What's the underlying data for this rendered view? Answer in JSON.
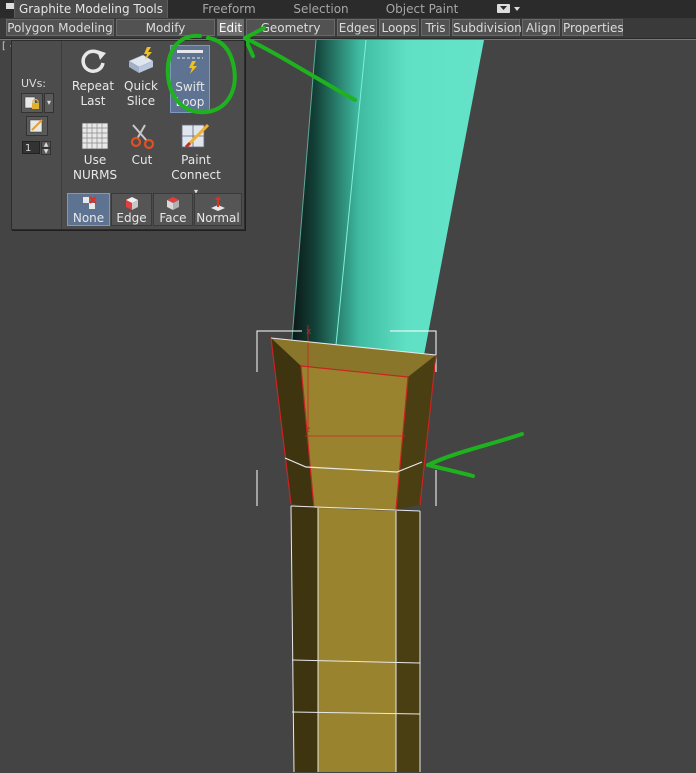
{
  "ribbon": {
    "tabs": [
      {
        "label": "Graphite Modeling Tools",
        "active": true
      },
      {
        "label": "Freeform",
        "active": false
      },
      {
        "label": "Selection",
        "active": false
      },
      {
        "label": "Object Paint",
        "active": false
      }
    ],
    "sub_tabs": [
      {
        "label": "Polygon Modeling",
        "active": false
      },
      {
        "label": "Modify Selection",
        "active": false
      },
      {
        "label": "Edit",
        "active": true
      },
      {
        "label": "Geometry (All)",
        "active": false
      },
      {
        "label": "Edges",
        "active": false
      },
      {
        "label": "Loops",
        "active": false
      },
      {
        "label": "Tris",
        "active": false
      },
      {
        "label": "Subdivision",
        "active": false
      },
      {
        "label": "Align",
        "active": false
      },
      {
        "label": "Properties",
        "active": false
      }
    ]
  },
  "viewport": {
    "label": "[ +"
  },
  "edit_panel": {
    "uvs_label": "UVs:",
    "uv_spinner_value": "1",
    "tools": [
      {
        "name": "repeat-last",
        "line1": "Repeat",
        "line2": "Last",
        "icon": "repeat-arrow-icon",
        "active": false
      },
      {
        "name": "quick-slice",
        "line1": "Quick",
        "line2": "Slice",
        "icon": "quick-slice-icon",
        "active": false
      },
      {
        "name": "swift-loop",
        "line1": "Swift",
        "line2": "Loop",
        "icon": "swift-loop-icon",
        "active": true
      },
      {
        "name": "use-nurms",
        "line1": "Use",
        "line2": "NURMS",
        "icon": "nurms-grid-icon",
        "active": false
      },
      {
        "name": "cut",
        "line1": "Cut",
        "line2": "",
        "icon": "scissors-icon",
        "active": false
      },
      {
        "name": "paint-connect",
        "line1": "Paint",
        "line2": "Connect",
        "icon": "paint-connect-icon",
        "active": false
      }
    ],
    "constraints": [
      {
        "label": "None",
        "icon": "constraint-none-icon",
        "active": true
      },
      {
        "label": "Edge",
        "icon": "constraint-edge-icon",
        "active": false
      },
      {
        "label": "Face",
        "icon": "constraint-face-icon",
        "active": false
      },
      {
        "label": "Normal",
        "icon": "constraint-normal-icon",
        "active": false
      }
    ]
  },
  "colors": {
    "viewport_bg": "#444444",
    "cyan_mesh": "#5fe0c4",
    "gold_mesh": "#9a832e",
    "annotation_green": "#1fb21f",
    "selection_red": "#cc2222",
    "active_tool_blue": "#5d7391"
  }
}
